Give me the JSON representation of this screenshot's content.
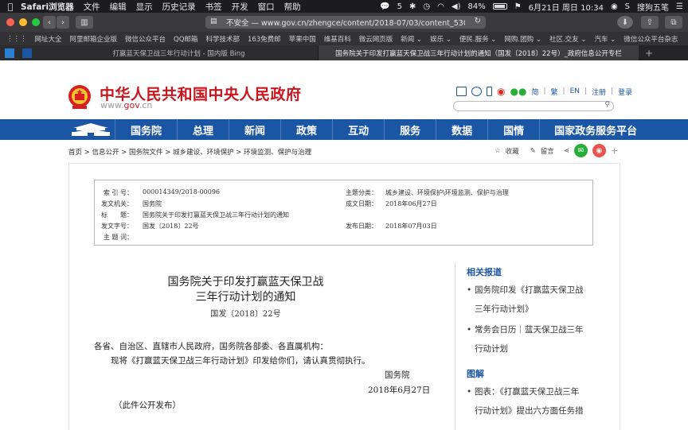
{
  "menubar": {
    "app_name": "Safari浏览器",
    "menus": [
      "文件",
      "编辑",
      "显示",
      "历史记录",
      "书签",
      "开发",
      "窗口",
      "帮助"
    ],
    "wechat_count": "5",
    "battery": "84%",
    "datetime": "6月21日 周日  10:34",
    "ime": "搜狗五笔"
  },
  "toolbar": {
    "address": "不安全 — www.gov.cn/zhengce/content/2018-07/03/content_5303158.htm"
  },
  "bookmarks": [
    "网址大全",
    "阿里邮箱企业版",
    "微信公众平台",
    "QQ邮箱",
    "科学技术部",
    "163免费邮",
    "苹果中国",
    "维基百科",
    "微云网页版",
    "新闻 ⌄",
    "娱乐 ⌄",
    "便民.服务 ⌄",
    "网购.团购 ⌄",
    "社区.交友 ⌄",
    "汽车 ⌄",
    "微信公众平台杂志"
  ],
  "tabs": [
    {
      "title": "打赢蓝天保卫战三年行动计划 - 国内版 Bing"
    },
    {
      "title": "国务院关于印发打赢蓝天保卫战三年行动计划的通知（国发〔2018〕22号）_政府信息公开专栏"
    }
  ],
  "site": {
    "title": "中华人民共和国中央人民政府",
    "url_prefix": "www.",
    "url_domain": "gov",
    "url_suffix": ".cn",
    "links": [
      "简",
      "繁",
      "EN",
      "注册",
      "登录"
    ]
  },
  "nav": [
    "国务院",
    "总理",
    "新闻",
    "政策",
    "互动",
    "服务",
    "数据",
    "国情",
    "国家政务服务平台"
  ],
  "breadcrumb": "首页 > 信息公开 > 国务院文件 > 城乡建设、环境保护 > 环境监测、保护与治理",
  "tools": {
    "favorite": "收藏",
    "comment": "留言",
    "plus": "+"
  },
  "meta": {
    "index_label": "索 引 号：",
    "index": "000014349/2018-00096",
    "topic_label": "主题分类：",
    "topic": "城乡建设、环境保护\\环境监测、保护与治理",
    "issuer_label": "发文机关：",
    "issuer": "国务院",
    "created_label": "成文日期：",
    "created": "2018年06月27日",
    "title_label": "标　　题：",
    "title": "国务院关于印发打赢蓝天保卫战三年行动计划的通知",
    "docno_label": "发文字号：",
    "docno": "国发〔2018〕22号",
    "published_label": "发布日期：",
    "published": "2018年07月03日",
    "keywords_label": "主 题 词："
  },
  "article": {
    "title_line1": "国务院关于印发打赢蓝天保卫战",
    "title_line2": "三年行动计划的通知",
    "doc_no": "国发〔2018〕22号",
    "addressee": "各省、自治区、直辖市人民政府，国务院各部委、各直属机构：",
    "body": "现将《打赢蓝天保卫战三年行动计划》印发给你们，请认真贯彻执行。",
    "signer": "国务院",
    "date": "2018年6月27日",
    "note": "（此件公开发布）"
  },
  "sidebar": {
    "related_heading": "相关报道",
    "related": [
      {
        "line1": "国务院印发《打赢蓝天保卫战",
        "line2": "三年行动计划》"
      },
      {
        "line1": "常务会日历｜蓝天保卫战三年",
        "line2": "行动计划"
      }
    ],
    "graphic_heading": "图解",
    "graphics": [
      {
        "line1": "图表：《打赢蓝天保卫战三年",
        "line2": "行动计划》提出六方面任务措"
      }
    ]
  }
}
